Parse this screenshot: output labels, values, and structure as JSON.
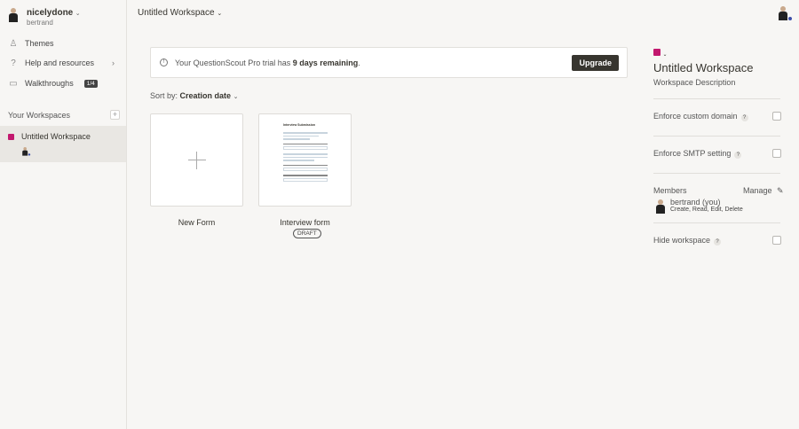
{
  "user": {
    "name": "nicelydone",
    "sub": "bertrand"
  },
  "nav": [
    {
      "label": "Themes",
      "icon": "brush-icon"
    },
    {
      "label": "Help and resources",
      "icon": "question-icon"
    },
    {
      "label": "Walkthroughs",
      "icon": "chat-icon",
      "badge": "1/4"
    }
  ],
  "workspaces": {
    "heading": "Your Workspaces",
    "items": [
      {
        "label": "Untitled Workspace",
        "color": "#c2186e"
      }
    ]
  },
  "header": {
    "title": "Untitled Workspace"
  },
  "trial": {
    "prefix": "Your QuestionScout Pro trial has ",
    "days": "9 days remaining",
    "suffix": ".",
    "upgrade": "Upgrade"
  },
  "sort": {
    "label": "Sort by:",
    "value": "Creation date"
  },
  "forms": [
    {
      "label": "New Form"
    },
    {
      "label": "Interview form",
      "status": "DRAFT",
      "preview_title": "Interview Submission"
    }
  ],
  "panel": {
    "title": "Untitled Workspace",
    "description": "Workspace Description",
    "custom_domain": "Enforce custom domain",
    "smtp": "Enforce SMTP setting",
    "members": "Members",
    "manage": "Manage",
    "member_name": "bertrand (you)",
    "member_perms": "Create, Read, Edit, Delete",
    "hide": "Hide workspace",
    "help": "?"
  }
}
